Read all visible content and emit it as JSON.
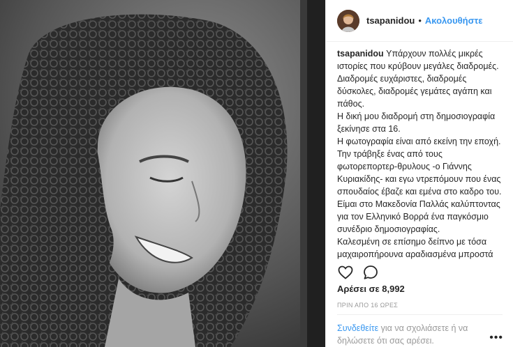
{
  "post": {
    "username": "tsapanidou",
    "separator": "•",
    "follow_label": "Ακολουθήστε",
    "caption_username": "tsapanidou",
    "caption_lines": [
      "Υπάρχουν πολλές μικρές ιστορίες που κρύβουν μεγάλες διαδρομές. Διαδρομές ευχάριστες, διαδρομές δύσκολες, διαδρομές γεμάτες αγάπη και πάθος.",
      "Η δική μου διαδρομή στη δημοσιογραφία ξεκίνησε στα 16.",
      "Η φωτογραφία είναι από εκείνη την εποχή.",
      "Την τράβηξε ένας από τους φωτορεπορτερ-θρυλους -ο Γιάννης Κυριακίδης- και εγω ντρεπόμουν που ένας σπουδαίος έβαζε και εμένα στο καδρο του.",
      "Είμαι στο Μακεδονία Παλλάς καλύπτοντας για τον Ελληνικό Βορρά ένα παγκόσμιο συνέδριο δημοσιογραφίας.",
      "Καλεσμένη σε επίσημο δείπνο με τόσα μαχαιροπήρουνα αραδιασμένα μπροστά"
    ],
    "likes_text": "Αρέσει σε 8,992",
    "time_text": "ΠΡΙΝ ΑΠΟ 16 ΩΡΕΣ",
    "login_link": "Συνδεθείτε",
    "login_rest": " για να σχολιάσετε ή να δηλώσετε ότι σας αρέσει.",
    "more_label": "•••",
    "icons": {
      "like": "heart-icon",
      "comment": "comment-icon"
    }
  }
}
